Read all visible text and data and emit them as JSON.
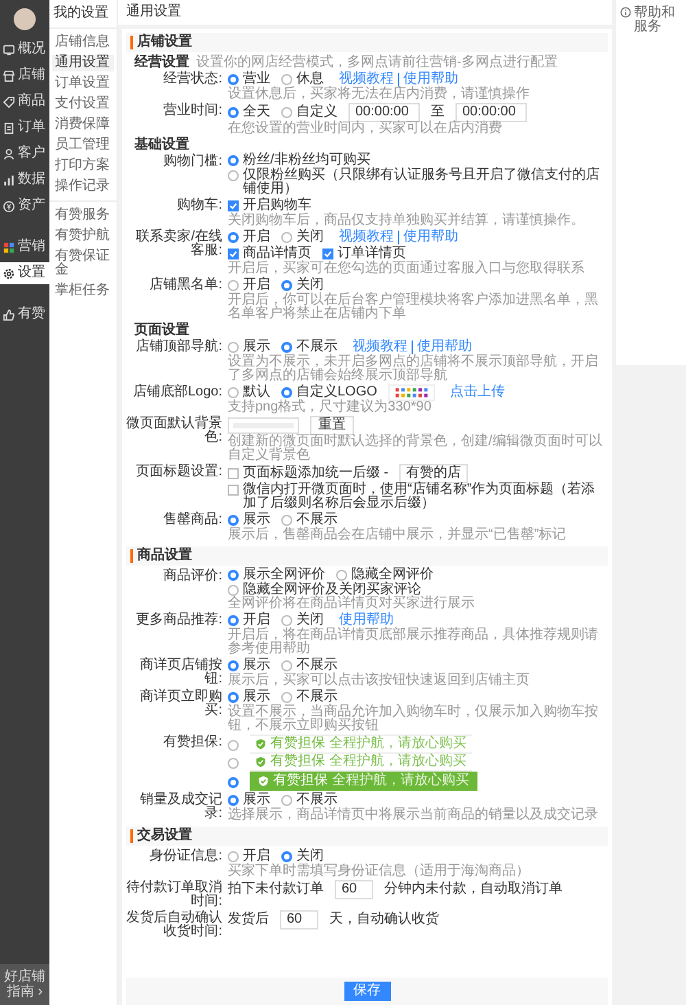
{
  "sidebar": {
    "groups": [
      [
        {
          "label": "概况",
          "selected": false
        },
        {
          "label": "店铺",
          "selected": false
        },
        {
          "label": "商品",
          "selected": false
        },
        {
          "label": "订单",
          "selected": false
        },
        {
          "label": "客户",
          "selected": false
        },
        {
          "label": "数据",
          "selected": false
        },
        {
          "label": "资产",
          "selected": false
        }
      ],
      [
        {
          "label": "营销",
          "selected": false
        },
        {
          "label": "设置",
          "selected": true
        }
      ],
      [
        {
          "label": "有赞",
          "selected": false
        }
      ]
    ],
    "footer": "好店铺指南 ›"
  },
  "submenu": {
    "title": "我的设置",
    "groups": [
      [
        {
          "label": "店铺信息",
          "selected": false
        },
        {
          "label": "通用设置",
          "selected": true
        },
        {
          "label": "订单设置",
          "selected": false
        },
        {
          "label": "支付设置",
          "selected": false
        },
        {
          "label": "消费保障",
          "selected": false
        },
        {
          "label": "员工管理",
          "selected": false
        },
        {
          "label": "打印方案",
          "selected": false
        },
        {
          "label": "操作记录",
          "selected": false
        }
      ],
      [
        {
          "label": "有赞服务",
          "selected": false
        },
        {
          "label": "有赞护航",
          "selected": false
        },
        {
          "label": "有赞保证金",
          "selected": false
        },
        {
          "label": "掌柜任务",
          "selected": false
        }
      ]
    ]
  },
  "page_title": "通用设置",
  "help": "帮助和服务",
  "sections": [
    {
      "title": "店铺设置",
      "blocks": [
        {
          "kind": "group",
          "title": "经营设置",
          "note": "设置你的网店经营模式，多网点请前往营销-多网点进行配置"
        },
        {
          "kind": "row",
          "label": "经营状态:",
          "lines": [
            [
              {
                "kind": "radio",
                "label": "营业",
                "selected": true
              },
              {
                "kind": "radio",
                "label": "休息",
                "selected": false
              },
              {
                "kind": "links",
                "items": [
                  "视频教程",
                  "使用帮助"
                ]
              }
            ]
          ],
          "hint": "设置休息后，买家将无法在店内消费，请谨慎操作"
        },
        {
          "kind": "row",
          "label": "营业时间:",
          "lines": [
            [
              {
                "kind": "radio",
                "label": "全天",
                "selected": true
              },
              {
                "kind": "radio",
                "label": "自定义",
                "selected": false
              },
              {
                "kind": "input",
                "value": "00:00:00"
              },
              {
                "kind": "text",
                "text": "至"
              },
              {
                "kind": "input",
                "value": "00:00:00"
              }
            ]
          ],
          "hint": "在您设置的营业时间内，买家可以在店内消费"
        },
        {
          "kind": "group",
          "title": "基础设置"
        },
        {
          "kind": "row",
          "label": "购物门槛:",
          "lines": [
            [
              {
                "kind": "radio",
                "label": "粉丝/非粉丝均可购买",
                "selected": true
              },
              {
                "kind": "radio",
                "label": "仅限粉丝购买（只限绑有认证服务号且开启了微信支付的店铺使用）",
                "selected": false
              }
            ]
          ]
        },
        {
          "kind": "row",
          "label": "购物车:",
          "lines": [
            [
              {
                "kind": "checkbox",
                "label": "开启购物车",
                "checked": true
              }
            ]
          ],
          "hint": "关闭购物车后，商品仅支持单独购买并结算，请谨慎操作。"
        },
        {
          "kind": "row",
          "label": "联系卖家/在线客服:",
          "lines": [
            [
              {
                "kind": "radio",
                "label": "开启",
                "selected": true
              },
              {
                "kind": "radio",
                "label": "关闭",
                "selected": false
              },
              {
                "kind": "links",
                "items": [
                  "视频教程",
                  "使用帮助"
                ]
              }
            ],
            [
              {
                "kind": "checkbox",
                "label": "商品详情页",
                "checked": true
              },
              {
                "kind": "checkbox",
                "label": "订单详情页",
                "checked": true
              }
            ]
          ],
          "hint": "开启后，买家可在您勾选的页面通过客服入口与您取得联系"
        },
        {
          "kind": "row",
          "label": "店铺黑名单:",
          "lines": [
            [
              {
                "kind": "radio",
                "label": "开启",
                "selected": false
              },
              {
                "kind": "radio",
                "label": "关闭",
                "selected": true
              }
            ]
          ],
          "hint": "开启后，你可以在后台客户管理模块将客户添加进黑名单，黑名单客户将禁止在店铺内下单"
        },
        {
          "kind": "group",
          "title": "页面设置"
        },
        {
          "kind": "row",
          "label": "店铺顶部导航:",
          "lines": [
            [
              {
                "kind": "radio",
                "label": "展示",
                "selected": false
              },
              {
                "kind": "radio",
                "label": "不展示",
                "selected": true
              },
              {
                "kind": "links",
                "items": [
                  "视频教程",
                  "使用帮助"
                ]
              }
            ]
          ],
          "hint": "设置为不展示，未开启多网点的店铺将不展示顶部导航，开启了多网点的店铺会始终展示顶部导航"
        },
        {
          "kind": "row",
          "label": "店铺底部Logo:",
          "lines": [
            [
              {
                "kind": "radio",
                "label": "默认",
                "selected": false
              },
              {
                "kind": "radio",
                "label": "自定义LOGO",
                "selected": true
              },
              {
                "kind": "logo"
              },
              {
                "kind": "links",
                "items": [
                  "点击上传"
                ]
              }
            ]
          ],
          "hint": "支持png格式，尺寸建议为330*90"
        },
        {
          "kind": "row",
          "label": "微页面默认背景色:",
          "lines": [
            [
              {
                "kind": "color"
              },
              {
                "kind": "button",
                "label": "重置"
              }
            ]
          ],
          "hint": "创建新的微页面时默认选择的背景色，创建/编辑微页面时可以自定义背景色"
        },
        {
          "kind": "row",
          "label": "页面标题设置:",
          "lines": [
            [
              {
                "kind": "checkbox",
                "label": "页面标题添加统一后缀 -",
                "checked": false
              },
              {
                "kind": "input",
                "value": "有赞的店"
              }
            ],
            [
              {
                "kind": "checkbox",
                "label": "微信内打开微页面时，使用“店铺名称”作为页面标题（若添加了后缀则名称后会显示后缀）",
                "checked": false
              }
            ]
          ]
        },
        {
          "kind": "row",
          "label": "售罄商品:",
          "lines": [
            [
              {
                "kind": "radio",
                "label": "展示",
                "selected": true
              },
              {
                "kind": "radio",
                "label": "不展示",
                "selected": false
              }
            ]
          ],
          "hint": "展示后，售罄商品会在店铺中展示，并显示“已售罄”标记"
        }
      ]
    },
    {
      "title": "商品设置",
      "blocks": [
        {
          "kind": "row",
          "label": "商品评价:",
          "lines": [
            [
              {
                "kind": "radio",
                "label": "展示全网评价",
                "selected": true
              },
              {
                "kind": "radio",
                "label": "隐藏全网评价",
                "selected": false
              },
              {
                "kind": "radio",
                "label": "隐藏全网评价及关闭买家评论",
                "selected": false
              }
            ]
          ],
          "hint": "全网评价将在商品详情页对买家进行展示"
        },
        {
          "kind": "row",
          "label": "更多商品推荐:",
          "lines": [
            [
              {
                "kind": "radio",
                "label": "开启",
                "selected": true
              },
              {
                "kind": "radio",
                "label": "关闭",
                "selected": false
              },
              {
                "kind": "links",
                "items": [
                  "使用帮助"
                ]
              }
            ]
          ],
          "hint": "开启后，将在商品详情页底部展示推荐商品，具体推荐规则请参考使用帮助"
        },
        {
          "kind": "row",
          "label": "商详页店铺按钮:",
          "lines": [
            [
              {
                "kind": "radio",
                "label": "展示",
                "selected": true
              },
              {
                "kind": "radio",
                "label": "不展示",
                "selected": false
              }
            ]
          ],
          "hint": "展示后，买家可以点击该按钮快速返回到店铺主页"
        },
        {
          "kind": "row",
          "label": "商详页立即购买:",
          "lines": [
            [
              {
                "kind": "radio",
                "label": "展示",
                "selected": true
              },
              {
                "kind": "radio",
                "label": "不展示",
                "selected": false
              }
            ]
          ],
          "hint": "设置不展示，当商品允许加入购物车时，仅展示加入购物车按钮，不展示立即购买按钮"
        },
        {
          "kind": "row",
          "label": "有赞担保:",
          "lines": [
            [
              {
                "kind": "radio",
                "selected": false
              },
              {
                "kind": "guarantee",
                "title": "有赞担保",
                "slogan": "全程护航，请放心购买"
              }
            ],
            [
              {
                "kind": "radio",
                "selected": false
              },
              {
                "kind": "guarantee",
                "title": "有赞担保",
                "slogan": "全程护航，请放心购买"
              }
            ],
            [
              {
                "kind": "radio",
                "selected": true
              },
              {
                "kind": "guarantee",
                "title": "有赞担保",
                "slogan": "全程护航，请放心购买"
              }
            ]
          ]
        },
        {
          "kind": "row",
          "label": "销量及成交记录:",
          "lines": [
            [
              {
                "kind": "radio",
                "label": "展示",
                "selected": true
              },
              {
                "kind": "radio",
                "label": "不展示",
                "selected": false
              }
            ]
          ],
          "hint": "选择展示，商品详情页中将展示当前商品的销量以及成交记录"
        }
      ]
    },
    {
      "title": "交易设置",
      "blocks": [
        {
          "kind": "row",
          "label": "身份证信息:",
          "lines": [
            [
              {
                "kind": "radio",
                "label": "开启",
                "selected": false
              },
              {
                "kind": "radio",
                "label": "关闭",
                "selected": true
              }
            ]
          ],
          "hint": "买家下单时需填写身份证信息（适用于海淘商品）"
        },
        {
          "kind": "row",
          "label": "待付款订单取消时间:",
          "lines": [
            [
              {
                "kind": "text",
                "text": "拍下未付款订单"
              },
              {
                "kind": "input",
                "value": "60"
              },
              {
                "kind": "text",
                "text": "分钟内未付款，自动取消订单"
              }
            ]
          ]
        },
        {
          "kind": "row",
          "label": "发货后自动确认收货时间:",
          "lines": [
            [
              {
                "kind": "text",
                "text": "发货后"
              },
              {
                "kind": "input",
                "value": "60"
              },
              {
                "kind": "text",
                "text": "天，自动确认收货"
              }
            ]
          ]
        }
      ]
    }
  ],
  "save": "保存"
}
